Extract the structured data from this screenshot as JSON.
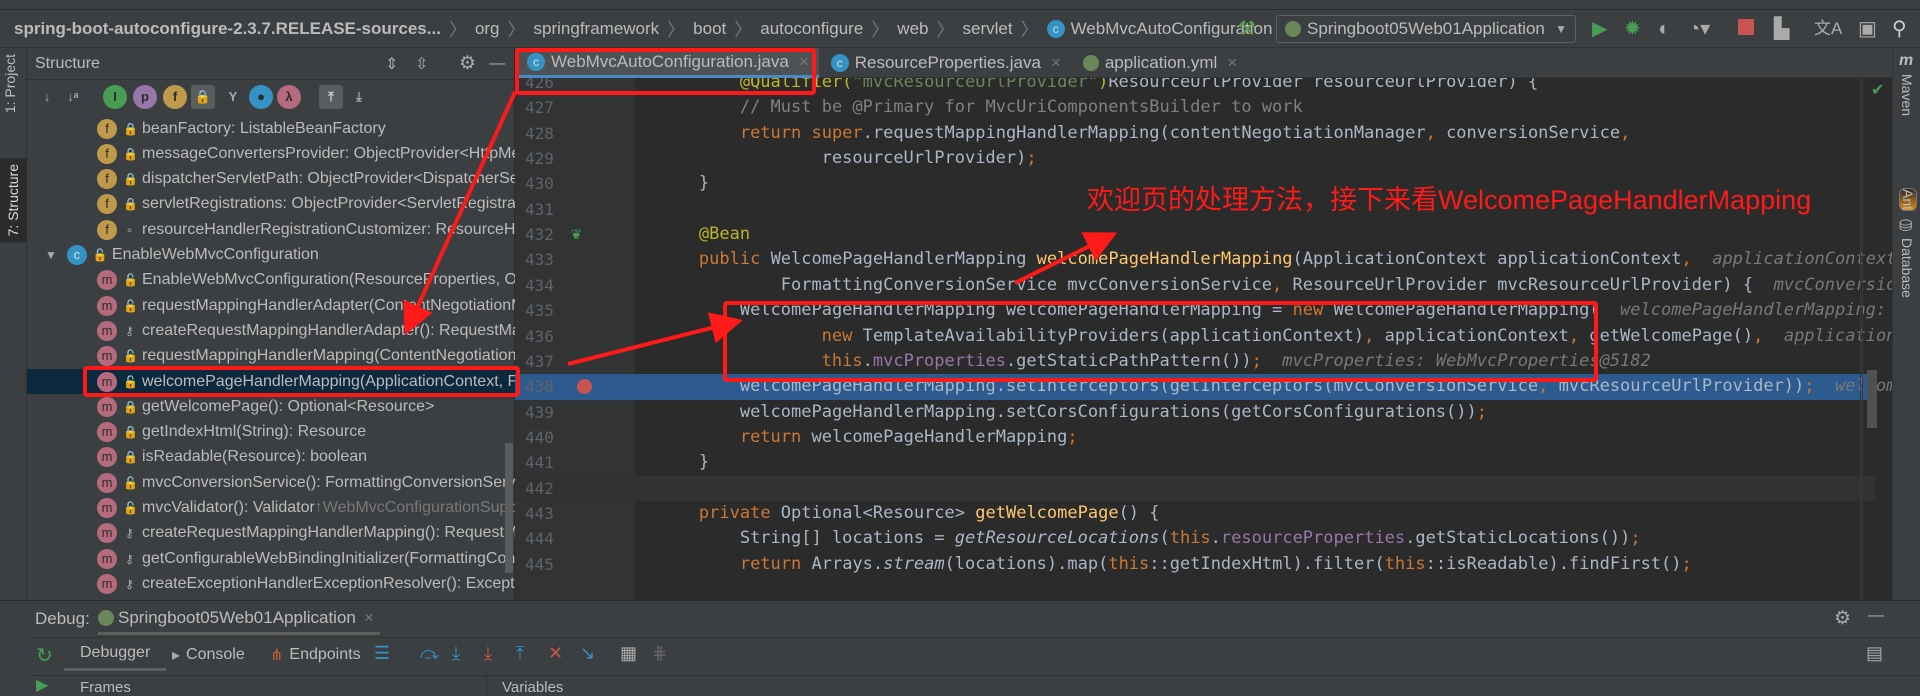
{
  "breadcrumb": {
    "items": [
      "spring-boot-autoconfigure-2.3.7.RELEASE-sources...",
      "org",
      "springframework",
      "boot",
      "autoconfigure",
      "web",
      "servlet",
      "WebMvcAutoConfiguration"
    ]
  },
  "toolbar": {
    "run_config": "Springboot05Web01Application",
    "icons": [
      "build-hammer-icon",
      "run-icon",
      "debug-icon",
      "coverage-icon",
      "profile-icon",
      "stop-icon",
      "project-structure-icon",
      "translate-icon",
      "presentation-icon",
      "search-icon"
    ]
  },
  "left_stripe": {
    "project": "1: Project",
    "structure": "7: Structure"
  },
  "right_stripe": {
    "maven": "Maven",
    "ant": "Ant",
    "database": "Database"
  },
  "structure": {
    "title": "Structure",
    "rows": [
      {
        "kind": "f",
        "vis": "private",
        "text": "beanFactory: ListableBeanFactory"
      },
      {
        "kind": "f",
        "vis": "private",
        "text": "messageConvertersProvider: ObjectProvider<HttpMessageConverters>"
      },
      {
        "kind": "f",
        "vis": "private",
        "text": "dispatcherServletPath: ObjectProvider<DispatcherServletPath>"
      },
      {
        "kind": "f",
        "vis": "private",
        "text": "servletRegistrations: ObjectProvider<ServletRegistrationBean<?>>"
      },
      {
        "kind": "f",
        "vis": "package",
        "text": "resourceHandlerRegistrationCustomizer: ResourceHandlerRegistrationCustomizer"
      },
      {
        "kind": "c",
        "vis": "public",
        "text": "EnableWebMvcConfiguration"
      },
      {
        "kind": "m",
        "vis": "public",
        "text": "EnableWebMvcConfiguration(ResourceProperties, ObjectProvider)"
      },
      {
        "kind": "m",
        "vis": "public",
        "text": "requestMappingHandlerAdapter(ContentNegotiationManager)"
      },
      {
        "kind": "m",
        "vis": "protected",
        "text": "createRequestMappingHandlerAdapter(): RequestMappingHandlerAdapter"
      },
      {
        "kind": "m",
        "vis": "public",
        "text": "requestMappingHandlerMapping(ContentNegotiationManager)"
      },
      {
        "kind": "m",
        "vis": "public",
        "text": "welcomePageHandlerMapping(ApplicationContext, FormattingConversionService)",
        "selected": true
      },
      {
        "kind": "m",
        "vis": "private",
        "text": "getWelcomePage(): Optional<Resource>"
      },
      {
        "kind": "m",
        "vis": "private",
        "text": "getIndexHtml(String): Resource"
      },
      {
        "kind": "m",
        "vis": "private",
        "text": "isReadable(Resource): boolean"
      },
      {
        "kind": "m",
        "vis": "public",
        "text": "mvcConversionService(): FormattingConversionService"
      },
      {
        "kind": "m",
        "vis": "public",
        "text": "mvcValidator(): Validator",
        "sub": " ↑WebMvcConfigurationSupport"
      },
      {
        "kind": "m",
        "vis": "protected",
        "text": "createRequestMappingHandlerMapping(): RequestMappingHandlerMapping"
      },
      {
        "kind": "m",
        "vis": "protected",
        "text": "getConfigurableWebBindingInitializer(FormattingConversionService)"
      },
      {
        "kind": "m",
        "vis": "protected",
        "text": "createExceptionHandlerExceptionResolver(): ExceptionHandlerExceptionResolver"
      }
    ]
  },
  "tabs": [
    {
      "label": "WebMvcAutoConfiguration.java",
      "icon": "class-icon",
      "active": true
    },
    {
      "label": "ResourceProperties.java",
      "icon": "class-icon"
    },
    {
      "label": "application.yml",
      "icon": "spring-yml-icon"
    }
  ],
  "code": {
    "execution_line": 438,
    "caret_line": 442,
    "lines": [
      {
        "n": "426",
        "i": 8,
        "s": [
          [
            "a",
            "@Qualifier("
          ],
          [
            "s",
            "\"mvcResourceUrlProvider\""
          ],
          [
            "a",
            ")"
          ],
          [
            "",
            "ResourceUrlProvider resourceUrlProvider) {"
          ]
        ]
      },
      {
        "n": "427",
        "i": 8,
        "s": [
          [
            "cm",
            "// Must be @Primary for MvcUriComponentsBuilder to work"
          ]
        ]
      },
      {
        "n": "428",
        "i": 8,
        "s": [
          [
            "k",
            "return super"
          ],
          [
            "",
            ".requestMappingHandlerMapping(contentNegotiationManager"
          ],
          [
            "k",
            ","
          ],
          [
            "",
            " conversionService"
          ],
          [
            "k",
            ","
          ]
        ]
      },
      {
        "n": "429",
        "i": 16,
        "s": [
          [
            "",
            "resourceUrlProvider)"
          ],
          [
            "k",
            ";"
          ]
        ]
      },
      {
        "n": "430",
        "i": 4,
        "s": [
          [
            "",
            "}"
          ]
        ]
      },
      {
        "n": "431",
        "i": 0,
        "s": []
      },
      {
        "n": "432",
        "i": 4,
        "s": [
          [
            "a",
            "@Bean"
          ]
        ]
      },
      {
        "n": "433",
        "i": 4,
        "s": [
          [
            "k",
            "public"
          ],
          [
            "",
            " WelcomePageHandlerMapping "
          ],
          [
            "md",
            "welcomePageHandlerMapping"
          ],
          [
            "",
            "(ApplicationContext applicationContext"
          ],
          [
            "k",
            ","
          ],
          [
            "h",
            "  applicationContext: "
          ]
        ]
      },
      {
        "n": "434",
        "i": 12,
        "s": [
          [
            "",
            "FormattingConversionService mvcConversionService"
          ],
          [
            "k",
            ","
          ],
          [
            "",
            " ResourceUrlProvider mvcResourceUrlProvider) {"
          ],
          [
            "h",
            "  mvcConversionSe"
          ]
        ]
      },
      {
        "n": "435",
        "i": 8,
        "s": [
          [
            "",
            "WelcomePageHandlerMapping welcomePageHandlerMapping = "
          ],
          [
            "k",
            "new"
          ],
          [
            "",
            " WelcomePageHandlerMapping("
          ],
          [
            "h",
            "  welcomePageHandlerMapping: We"
          ]
        ]
      },
      {
        "n": "436",
        "i": 16,
        "s": [
          [
            "k",
            "new"
          ],
          [
            "",
            " TemplateAvailabilityProviders(applicationContext)"
          ],
          [
            "k",
            ","
          ],
          [
            "",
            " applicationContext"
          ],
          [
            "k",
            ","
          ],
          [
            "",
            " getWelcomePage()"
          ],
          [
            "k",
            ","
          ],
          [
            "h",
            "  applicationCon"
          ]
        ]
      },
      {
        "n": "437",
        "i": 16,
        "s": [
          [
            "k",
            "this"
          ],
          [
            "",
            "."
          ],
          [
            "fd",
            "mvcProperties"
          ],
          [
            "",
            ".getStaticPathPattern())"
          ],
          [
            "k",
            ";"
          ],
          [
            "h",
            "  mvcProperties: WebMvcProperties@5182"
          ]
        ]
      },
      {
        "n": "438",
        "i": 8,
        "s": [
          [
            "",
            "welcomePageHandlerMapping.setInterceptors(getInterceptors(mvcConversionService"
          ],
          [
            "k",
            ","
          ],
          [
            "",
            " mvcResourceUrlProvider))"
          ],
          [
            "k",
            ";"
          ],
          [
            "h",
            "  welcomePa"
          ]
        ]
      },
      {
        "n": "439",
        "i": 8,
        "s": [
          [
            "",
            "welcomePageHandlerMapping.setCorsConfigurations(getCorsConfigurations())"
          ],
          [
            "k",
            ";"
          ]
        ]
      },
      {
        "n": "440",
        "i": 8,
        "s": [
          [
            "k",
            "return"
          ],
          [
            "",
            " welcomePageHandlerMapping"
          ],
          [
            "k",
            ";"
          ]
        ]
      },
      {
        "n": "441",
        "i": 4,
        "s": [
          [
            "",
            "}"
          ]
        ]
      },
      {
        "n": "442",
        "i": 0,
        "s": []
      },
      {
        "n": "443",
        "i": 4,
        "s": [
          [
            "k",
            "private"
          ],
          [
            "",
            " Optional<Resource> "
          ],
          [
            "md",
            "getWelcomePage"
          ],
          [
            "",
            "() {"
          ]
        ]
      },
      {
        "n": "444",
        "i": 8,
        "s": [
          [
            "",
            "String[] locations = "
          ],
          [
            "it",
            "getResourceLocations"
          ],
          [
            "",
            "("
          ],
          [
            "k",
            "this"
          ],
          [
            "",
            "."
          ],
          [
            "fd",
            "resourceProperties"
          ],
          [
            "",
            ".getStaticLocations())"
          ],
          [
            "k",
            ";"
          ]
        ]
      },
      {
        "n": "445",
        "i": 8,
        "s": [
          [
            "k",
            "return"
          ],
          [
            "",
            " Arrays."
          ],
          [
            "it",
            "stream"
          ],
          [
            "",
            "(locations).map("
          ],
          [
            "k",
            "this"
          ],
          [
            "",
            "::getIndexHtml).filter("
          ],
          [
            "k",
            "this"
          ],
          [
            "",
            "::isReadable).findFirst()"
          ],
          [
            "k",
            ";"
          ]
        ]
      }
    ]
  },
  "annotation": {
    "text": "欢迎页的处理方法，接下来看WelcomePageHandlerMapping",
    "color": "#ff1a1a"
  },
  "debug": {
    "label": "Debug:",
    "session": "Springboot05Web01Application",
    "tabs": [
      "Debugger",
      "Console",
      "Endpoints"
    ],
    "frames": "Frames",
    "variables": "Variables"
  },
  "colors": {
    "editor_bg": "#2b2b2b",
    "panel_bg": "#3c3f41",
    "selection": "#0d293e",
    "execution_line": "#2d5b8f",
    "keyword": "#cc7832",
    "annotation_red": "#ff1a1a"
  }
}
